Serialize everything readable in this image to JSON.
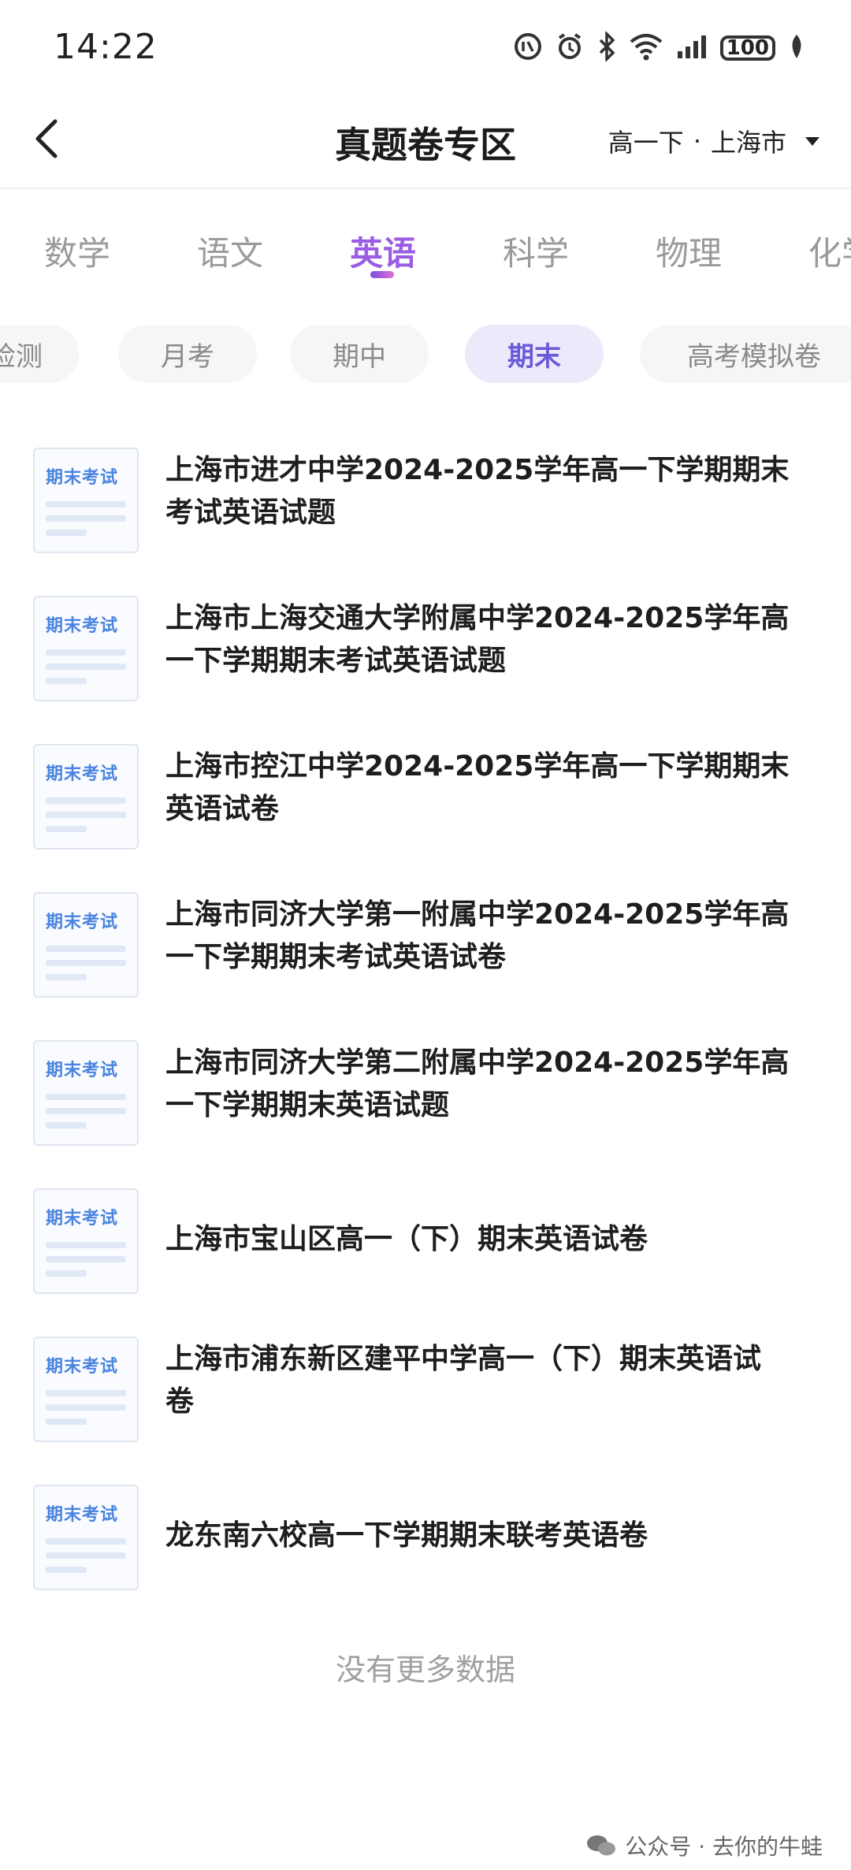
{
  "status_bar": {
    "time": "14:22",
    "battery": "100"
  },
  "header": {
    "title": "真题卷专区",
    "grade": "高一下",
    "separator": "·",
    "region": "上海市"
  },
  "subjects": [
    "数学",
    "语文",
    "英语",
    "科学",
    "物理",
    "化学"
  ],
  "active_subject": "英语",
  "filters": [
    "检测",
    "月考",
    "期中",
    "期末",
    "高考模拟卷"
  ],
  "active_filter": "期末",
  "thumb_label": "期末考试",
  "papers": [
    {
      "line1": "上海市进才中学2024-2025学年高一下学期期末",
      "line2": "考试英语试题"
    },
    {
      "line1": "上海市上海交通大学附属中学2024-2025学年高",
      "line2": "一下学期期末考试英语试题"
    },
    {
      "line1": "上海市控江中学2024-2025学年高一下学期期末",
      "line2": "英语试卷"
    },
    {
      "line1": "上海市同济大学第一附属中学2024-2025学年高",
      "line2": "一下学期期末考试英语试卷"
    },
    {
      "line1": "上海市同济大学第二附属中学2024-2025学年高",
      "line2": "一下学期期末英语试题"
    },
    {
      "line1": "上海市宝山区高一（下）期末英语试卷",
      "line2": ""
    },
    {
      "line1": "上海市浦东新区建平中学高一（下）期末英语试",
      "line2": "卷"
    },
    {
      "line1": "龙东南六校高一下学期期末联考英语卷",
      "line2": ""
    }
  ],
  "footer": {
    "no_more": "没有更多数据",
    "watermark": "公众号 · 去你的牛蛙"
  },
  "colors": {
    "accent": "#9b5de5",
    "chip_active_bg": "#ece9fb",
    "chip_active_text": "#6a5ad8",
    "thumb_label": "#4a84e0"
  }
}
